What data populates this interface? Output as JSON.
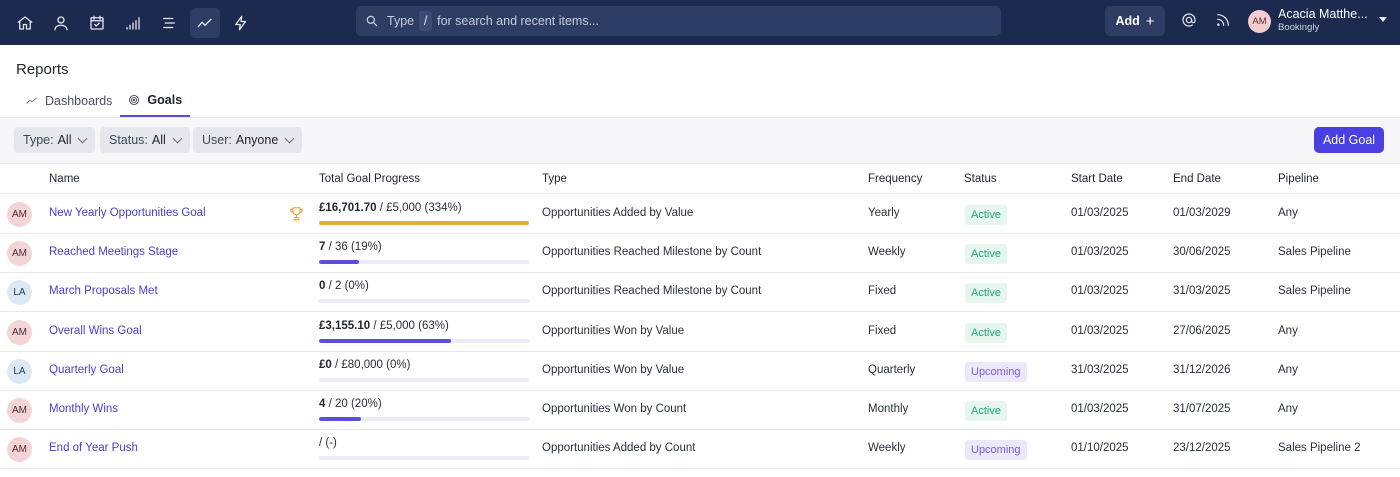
{
  "topbar": {
    "search_placeholder_pre": "Type",
    "search_slash": "/",
    "search_placeholder_post": "for search and recent items...",
    "add_label": "Add",
    "user_initials": "AM",
    "user_name": "Acacia Matthe...",
    "company": "Bookingly"
  },
  "page": {
    "title": "Reports",
    "tabs": [
      {
        "label": "Dashboards",
        "icon": "trend-line-icon",
        "active": false
      },
      {
        "label": "Goals",
        "icon": "goal-target-icon",
        "active": true
      }
    ]
  },
  "filters": [
    {
      "key": "Type:",
      "value": "All"
    },
    {
      "key": "Status:",
      "value": "All"
    },
    {
      "key": "User:",
      "value": "Anyone"
    }
  ],
  "add_goal_label": "Add Goal",
  "table": {
    "columns": [
      "Name",
      "Total Goal Progress",
      "Type",
      "Frequency",
      "Status",
      "Start Date",
      "End Date",
      "Pipeline"
    ],
    "rows": [
      {
        "initials": "AM",
        "name": "New Yearly Opportunities Goal",
        "trophy": true,
        "progress_current": "£16,701.70",
        "progress_rest": " / £5,000 (334%)",
        "progress_fraction": 1.0,
        "progress_color": "#e7a83c",
        "type": "Opportunities Added by Value",
        "frequency": "Yearly",
        "status": "Active",
        "start": "01/03/2025",
        "end": "01/03/2029",
        "pipeline": "Any"
      },
      {
        "initials": "AM",
        "name": "Reached Meetings Stage",
        "trophy": false,
        "progress_current": "7",
        "progress_rest": " / 36 (19%)",
        "progress_fraction": 0.19,
        "progress_color": "#5b4de0",
        "type": "Opportunities Reached Milestone by Count",
        "frequency": "Weekly",
        "status": "Active",
        "start": "01/03/2025",
        "end": "30/06/2025",
        "pipeline": "Sales Pipeline"
      },
      {
        "initials": "LA",
        "name": "March Proposals Met",
        "trophy": false,
        "progress_current": "0",
        "progress_rest": " / 2 (0%)",
        "progress_fraction": 0.0,
        "progress_color": "#5b4de0",
        "type": "Opportunities Reached Milestone by Count",
        "frequency": "Fixed",
        "status": "Active",
        "start": "01/03/2025",
        "end": "31/03/2025",
        "pipeline": "Sales Pipeline"
      },
      {
        "initials": "AM",
        "name": "Overall Wins Goal",
        "trophy": false,
        "progress_current": "£3,155.10",
        "progress_rest": " / £5,000 (63%)",
        "progress_fraction": 0.63,
        "progress_color": "#5b4de0",
        "type": "Opportunities Won by Value",
        "frequency": "Fixed",
        "status": "Active",
        "start": "01/03/2025",
        "end": "27/06/2025",
        "pipeline": "Any"
      },
      {
        "initials": "LA",
        "name": "Quarterly Goal",
        "trophy": false,
        "progress_current": "£0",
        "progress_rest": " / £80,000 (0%)",
        "progress_fraction": 0.0,
        "progress_color": "#5b4de0",
        "type": "Opportunities Won by Value",
        "frequency": "Quarterly",
        "status": "Upcoming",
        "start": "31/03/2025",
        "end": "31/12/2026",
        "pipeline": "Any"
      },
      {
        "initials": "AM",
        "name": "Monthly Wins",
        "trophy": false,
        "progress_current": "4",
        "progress_rest": " / 20 (20%)",
        "progress_fraction": 0.2,
        "progress_color": "#5b4de0",
        "type": "Opportunities Won by Count",
        "frequency": "Monthly",
        "status": "Active",
        "start": "01/03/2025",
        "end": "31/07/2025",
        "pipeline": "Any"
      },
      {
        "initials": "AM",
        "name": "End of Year Push",
        "trophy": false,
        "progress_current": "",
        "progress_rest": " /  (-)",
        "progress_fraction": 0.0,
        "progress_color": "#5b4de0",
        "type": "Opportunities Added by Count",
        "frequency": "Weekly",
        "status": "Upcoming",
        "start": "01/10/2025",
        "end": "23/12/2025",
        "pipeline": "Sales Pipeline 2"
      }
    ]
  }
}
